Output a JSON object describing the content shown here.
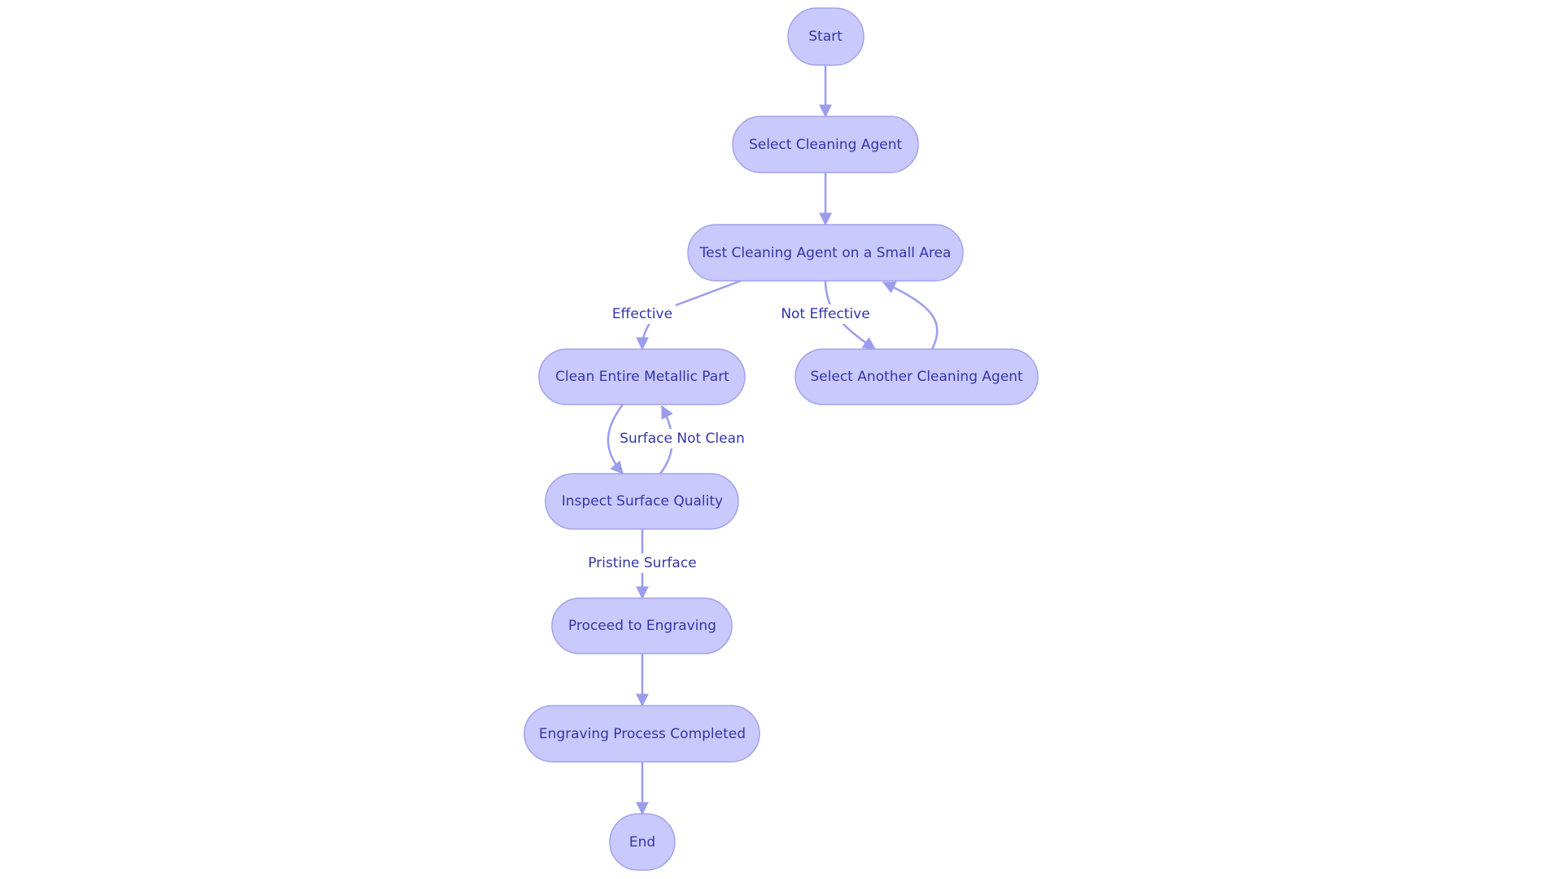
{
  "nodes": {
    "start": "Start",
    "select_agent": "Select Cleaning Agent",
    "test_agent": "Test Cleaning Agent on a Small Area",
    "clean_part": "Clean Entire Metallic Part",
    "select_another": "Select Another Cleaning Agent",
    "inspect": "Inspect Surface Quality",
    "proceed": "Proceed to Engraving",
    "completed": "Engraving Process Completed",
    "end": "End"
  },
  "edge_labels": {
    "effective": "Effective",
    "not_effective": "Not Effective",
    "surface_not_clean": "Surface Not Clean",
    "pristine_surface": "Pristine Surface"
  },
  "colors": {
    "node_fill": "#c9c9fd",
    "node_stroke": "#a2a2ec",
    "edge": "#9c9ced",
    "text": "#3535a8"
  }
}
